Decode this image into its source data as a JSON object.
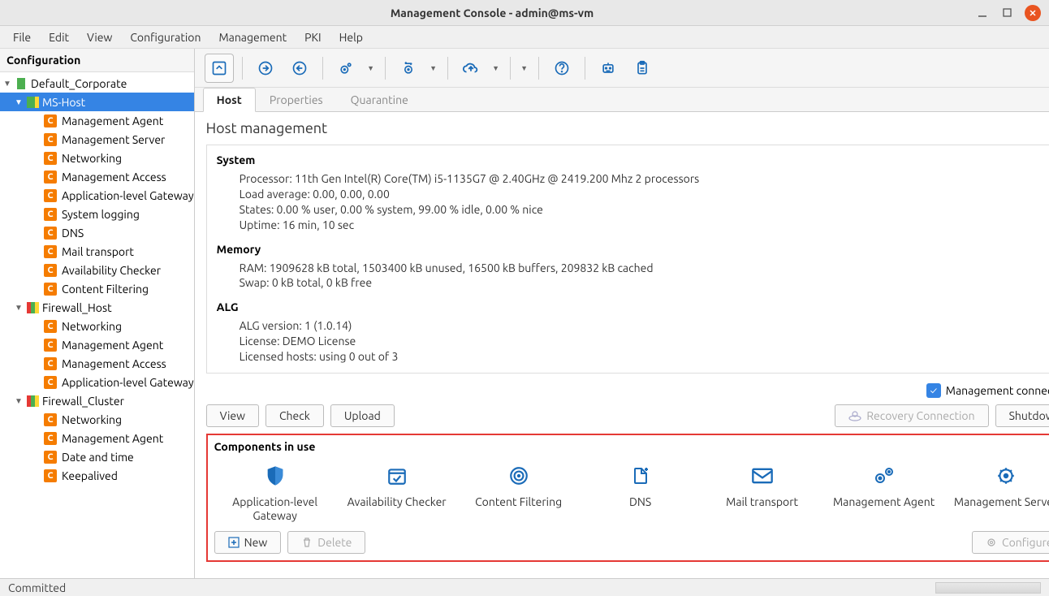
{
  "window": {
    "title": "Management Console - admin@ms-vm"
  },
  "menu": [
    "File",
    "Edit",
    "View",
    "Configuration",
    "Management",
    "PKI",
    "Help"
  ],
  "sidebar": {
    "title": "Configuration",
    "tree": [
      {
        "type": "site",
        "label": "Default_Corporate",
        "colors": [
          "green",
          "green"
        ],
        "expanded": true,
        "indent": 0
      },
      {
        "type": "host",
        "label": "MS-Host",
        "colors": [
          "green",
          "green",
          "yellow"
        ],
        "expanded": true,
        "selected": true,
        "indent": 1
      },
      {
        "type": "comp",
        "label": "Management Agent",
        "indent": 2
      },
      {
        "type": "comp",
        "label": "Management Server",
        "indent": 2
      },
      {
        "type": "comp",
        "label": "Networking",
        "indent": 2
      },
      {
        "type": "comp",
        "label": "Management Access",
        "indent": 2
      },
      {
        "type": "comp",
        "label": "Application-level Gateway",
        "indent": 2
      },
      {
        "type": "comp",
        "label": "System logging",
        "indent": 2
      },
      {
        "type": "comp",
        "label": "DNS",
        "indent": 2
      },
      {
        "type": "comp",
        "label": "Mail transport",
        "indent": 2
      },
      {
        "type": "comp",
        "label": "Availability Checker",
        "indent": 2
      },
      {
        "type": "comp",
        "label": "Content Filtering",
        "indent": 2
      },
      {
        "type": "host",
        "label": "Firewall_Host",
        "colors": [
          "red",
          "green",
          "yellow"
        ],
        "expanded": true,
        "indent": 1
      },
      {
        "type": "comp",
        "label": "Networking",
        "indent": 2
      },
      {
        "type": "comp",
        "label": "Management Agent",
        "indent": 2
      },
      {
        "type": "comp",
        "label": "Management Access",
        "indent": 2
      },
      {
        "type": "comp",
        "label": "Application-level Gateway",
        "indent": 2
      },
      {
        "type": "host",
        "label": "Firewall_Cluster",
        "colors": [
          "red",
          "green",
          "yellow"
        ],
        "expanded": true,
        "indent": 1
      },
      {
        "type": "comp",
        "label": "Networking",
        "indent": 2
      },
      {
        "type": "comp",
        "label": "Management Agent",
        "indent": 2
      },
      {
        "type": "comp",
        "label": "Date and time",
        "indent": 2
      },
      {
        "type": "comp",
        "label": "Keepalived",
        "indent": 2
      }
    ]
  },
  "tabs": [
    {
      "label": "Host",
      "active": true
    },
    {
      "label": "Properties",
      "active": false
    },
    {
      "label": "Quarantine",
      "active": false
    }
  ],
  "panel": {
    "title": "Host management",
    "system": {
      "heading": "System",
      "processor": "Processor: 11th Gen Intel(R) Core(TM) i5-1135G7 @ 2.40GHz @ 2419.200 Mhz 2 processors",
      "load": "Load average: 0.00, 0.00, 0.00",
      "states": "States: 0.00 % user, 0.00 % system, 99.00 % idle, 0.00 % nice",
      "uptime": "Uptime: 16 min, 10 sec"
    },
    "memory": {
      "heading": "Memory",
      "ram": "RAM: 1909628 kB total, 1503400 kB unused, 16500 kB buffers, 209832 kB cached",
      "swap": "Swap: 0 kB total, 0 kB free"
    },
    "alg": {
      "heading": "ALG",
      "version": "ALG version: 1 (1.0.14)",
      "license": "License: DEMO License",
      "hosts": "Licensed hosts: using 0 out of 3"
    },
    "mgmt_connection_label": "Management connection",
    "buttons": {
      "view": "View",
      "check": "Check",
      "upload": "Upload",
      "recovery": "Recovery Connection",
      "shutdown": "Shutdown"
    }
  },
  "components": {
    "title": "Components in use",
    "items": [
      {
        "label": "Application-level Gateway",
        "icon": "shield"
      },
      {
        "label": "Availability Checker",
        "icon": "calendar-check"
      },
      {
        "label": "Content Filtering",
        "icon": "target"
      },
      {
        "label": "DNS",
        "icon": "file-plus"
      },
      {
        "label": "Mail transport",
        "icon": "mail"
      },
      {
        "label": "Management Agent",
        "icon": "gears"
      },
      {
        "label": "Management Server",
        "icon": "gear"
      }
    ],
    "buttons": {
      "new": "New",
      "delete": "Delete",
      "configure": "Configure"
    }
  },
  "statusbar": {
    "text": "Committed"
  }
}
